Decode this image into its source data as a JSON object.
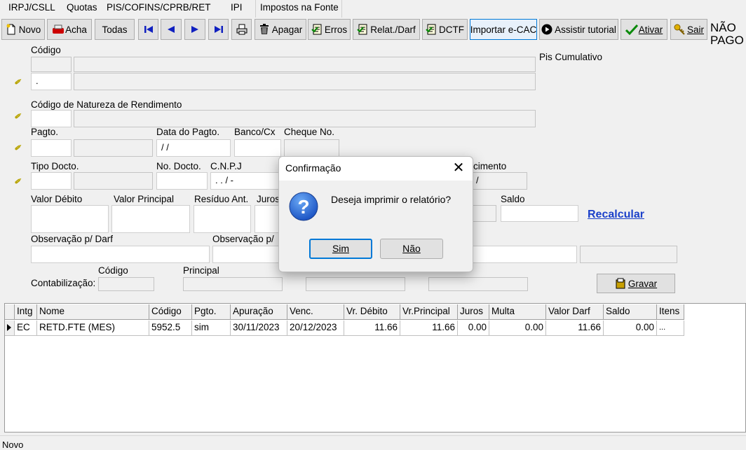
{
  "tabs": [
    {
      "label": "IRPJ/CSLL"
    },
    {
      "label": "Quotas"
    },
    {
      "label": "PIS/COFINS/CPRB/RET"
    },
    {
      "label": "IPI"
    },
    {
      "label": "Impostos na Fonte"
    }
  ],
  "toolbar": {
    "novo": "Novo",
    "acha": "Acha",
    "todas": "Todas",
    "apagar": "Apagar",
    "erros": "Erros",
    "relat": "Relat./Darf",
    "dctf": "DCTF",
    "importar": "Importar e-CAC",
    "tutorial": "Assistir tutorial",
    "ativar": "Ativar",
    "sair": "Sair",
    "status_line1": "NÃO",
    "status_line2": "PAGO"
  },
  "form": {
    "codigo_label": "Código",
    "pis_cumulativo": "Pis Cumulativo",
    "codigo2_value": ".",
    "natureza_label": "Código de Natureza de Rendimento",
    "pagto_label": "Pagto.",
    "data_pagto_label": "Data do Pagto.",
    "data_pagto_value": " / /",
    "banco_label": "Banco/Cx",
    "cheque_label": "Cheque No.",
    "tipo_docto_label": "Tipo Docto.",
    "no_docto_label": "No. Docto.",
    "cnpj_label": "C.N.P.J",
    "cnpj_value": " .  .  /  -",
    "vencimento_label_partial": "cimento",
    "vencimento_value_partial": "/",
    "valor_debito_label": "Valor Débito",
    "valor_principal_label": "Valor Principal",
    "residuo_label": "Resíduo Ant.",
    "juros_label_partial": "Juros",
    "saldo_label": "Saldo",
    "recalcular": "Recalcular",
    "obs_darf_label": "Observação p/ Darf",
    "obs2_label_partial": "Observação p/",
    "contab_label": "Contabilização:",
    "contab_codigo": "Código",
    "contab_principal": "Principal",
    "gravar": "Gravar"
  },
  "grid": {
    "headers": [
      "Intg",
      "Nome",
      "Código",
      "Pgto.",
      "Apuração",
      "Venc.",
      "Vr. Débito",
      "Vr.Principal",
      "Juros",
      "Multa",
      "Valor Darf",
      "Saldo",
      "Itens"
    ],
    "rows": [
      [
        "EC",
        "RETD.FTE (MES)",
        "5952.5",
        "sim",
        "30/11/2023",
        "20/12/2023",
        "11.66",
        "11.66",
        "0.00",
        "0.00",
        "11.66",
        "0.00",
        "..."
      ]
    ]
  },
  "dialog": {
    "title": "Confirmação",
    "message": "Deseja imprimir o relatório?",
    "yes": "Sim",
    "no": "Não"
  },
  "statusbar": {
    "text": "Novo"
  }
}
